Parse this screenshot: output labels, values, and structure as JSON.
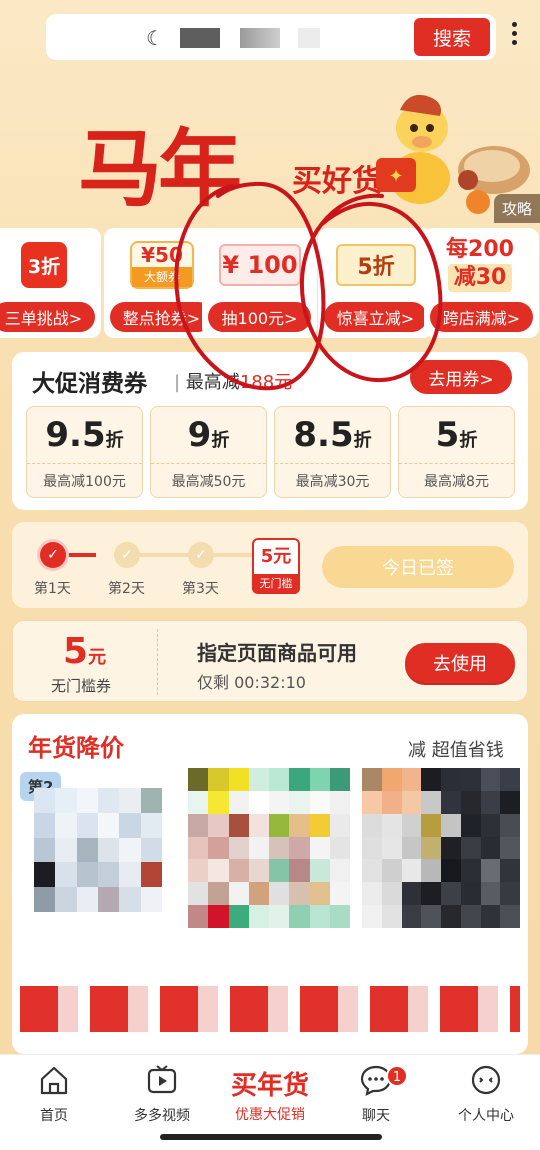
{
  "search": {
    "button": "搜索",
    "loading_icon": "spinner-icon"
  },
  "banner": {
    "title": "马年",
    "subtitle": "买好货",
    "strategy": "攻略"
  },
  "entries": [
    {
      "visual": "3折",
      "label": "三单挑战>"
    },
    {
      "visual_price": "¥50",
      "visual_tag": "大额券",
      "label": "整点抢券>"
    },
    {
      "visual": "¥ 100",
      "label": "抽100元>"
    },
    {
      "visual": "5折",
      "label": "惊喜立减>"
    },
    {
      "visual_top": "每200",
      "visual_bottom": "减30",
      "label": "跨店满减>"
    }
  ],
  "coupons": {
    "title": "大促消费券",
    "subtitle_prefix": "最高减",
    "subtitle_amount": "188元",
    "use_button": "去用券>",
    "items": [
      {
        "disc": "9.5",
        "unit": "折",
        "cap": "最高减100元"
      },
      {
        "disc": "9",
        "unit": "折",
        "cap": "最高减50元"
      },
      {
        "disc": "8.5",
        "unit": "折",
        "cap": "最高减30元"
      },
      {
        "disc": "5",
        "unit": "折",
        "cap": "最高减8元"
      }
    ]
  },
  "checkin": {
    "days": [
      "第1天",
      "第2天",
      "第3天"
    ],
    "completed_days": 1,
    "reward_value": "5元",
    "reward_tag": "无门槛",
    "signed_label": "今日已签"
  },
  "ticket": {
    "value": "5",
    "unit": "元",
    "threshold": "无门槛券",
    "description": "指定页面商品可用",
    "timer": "仅剩 00:32:10",
    "use_button": "去使用"
  },
  "products": {
    "title": "年货降价",
    "slogan": "减 超值省钱",
    "tag": "第2"
  },
  "tabbar": [
    {
      "icon": "home-icon",
      "label": "首页"
    },
    {
      "icon": "video-icon",
      "label": "多多视频"
    },
    {
      "big": "买年货",
      "label": "优惠大促销"
    },
    {
      "icon": "chat-icon",
      "label": "聊天",
      "badge": "1"
    },
    {
      "icon": "profile-icon",
      "label": "个人中心"
    }
  ],
  "colors": {
    "brand_red": "#e02e24",
    "background": "#f8dfb0",
    "annotation": "#c8141a"
  }
}
